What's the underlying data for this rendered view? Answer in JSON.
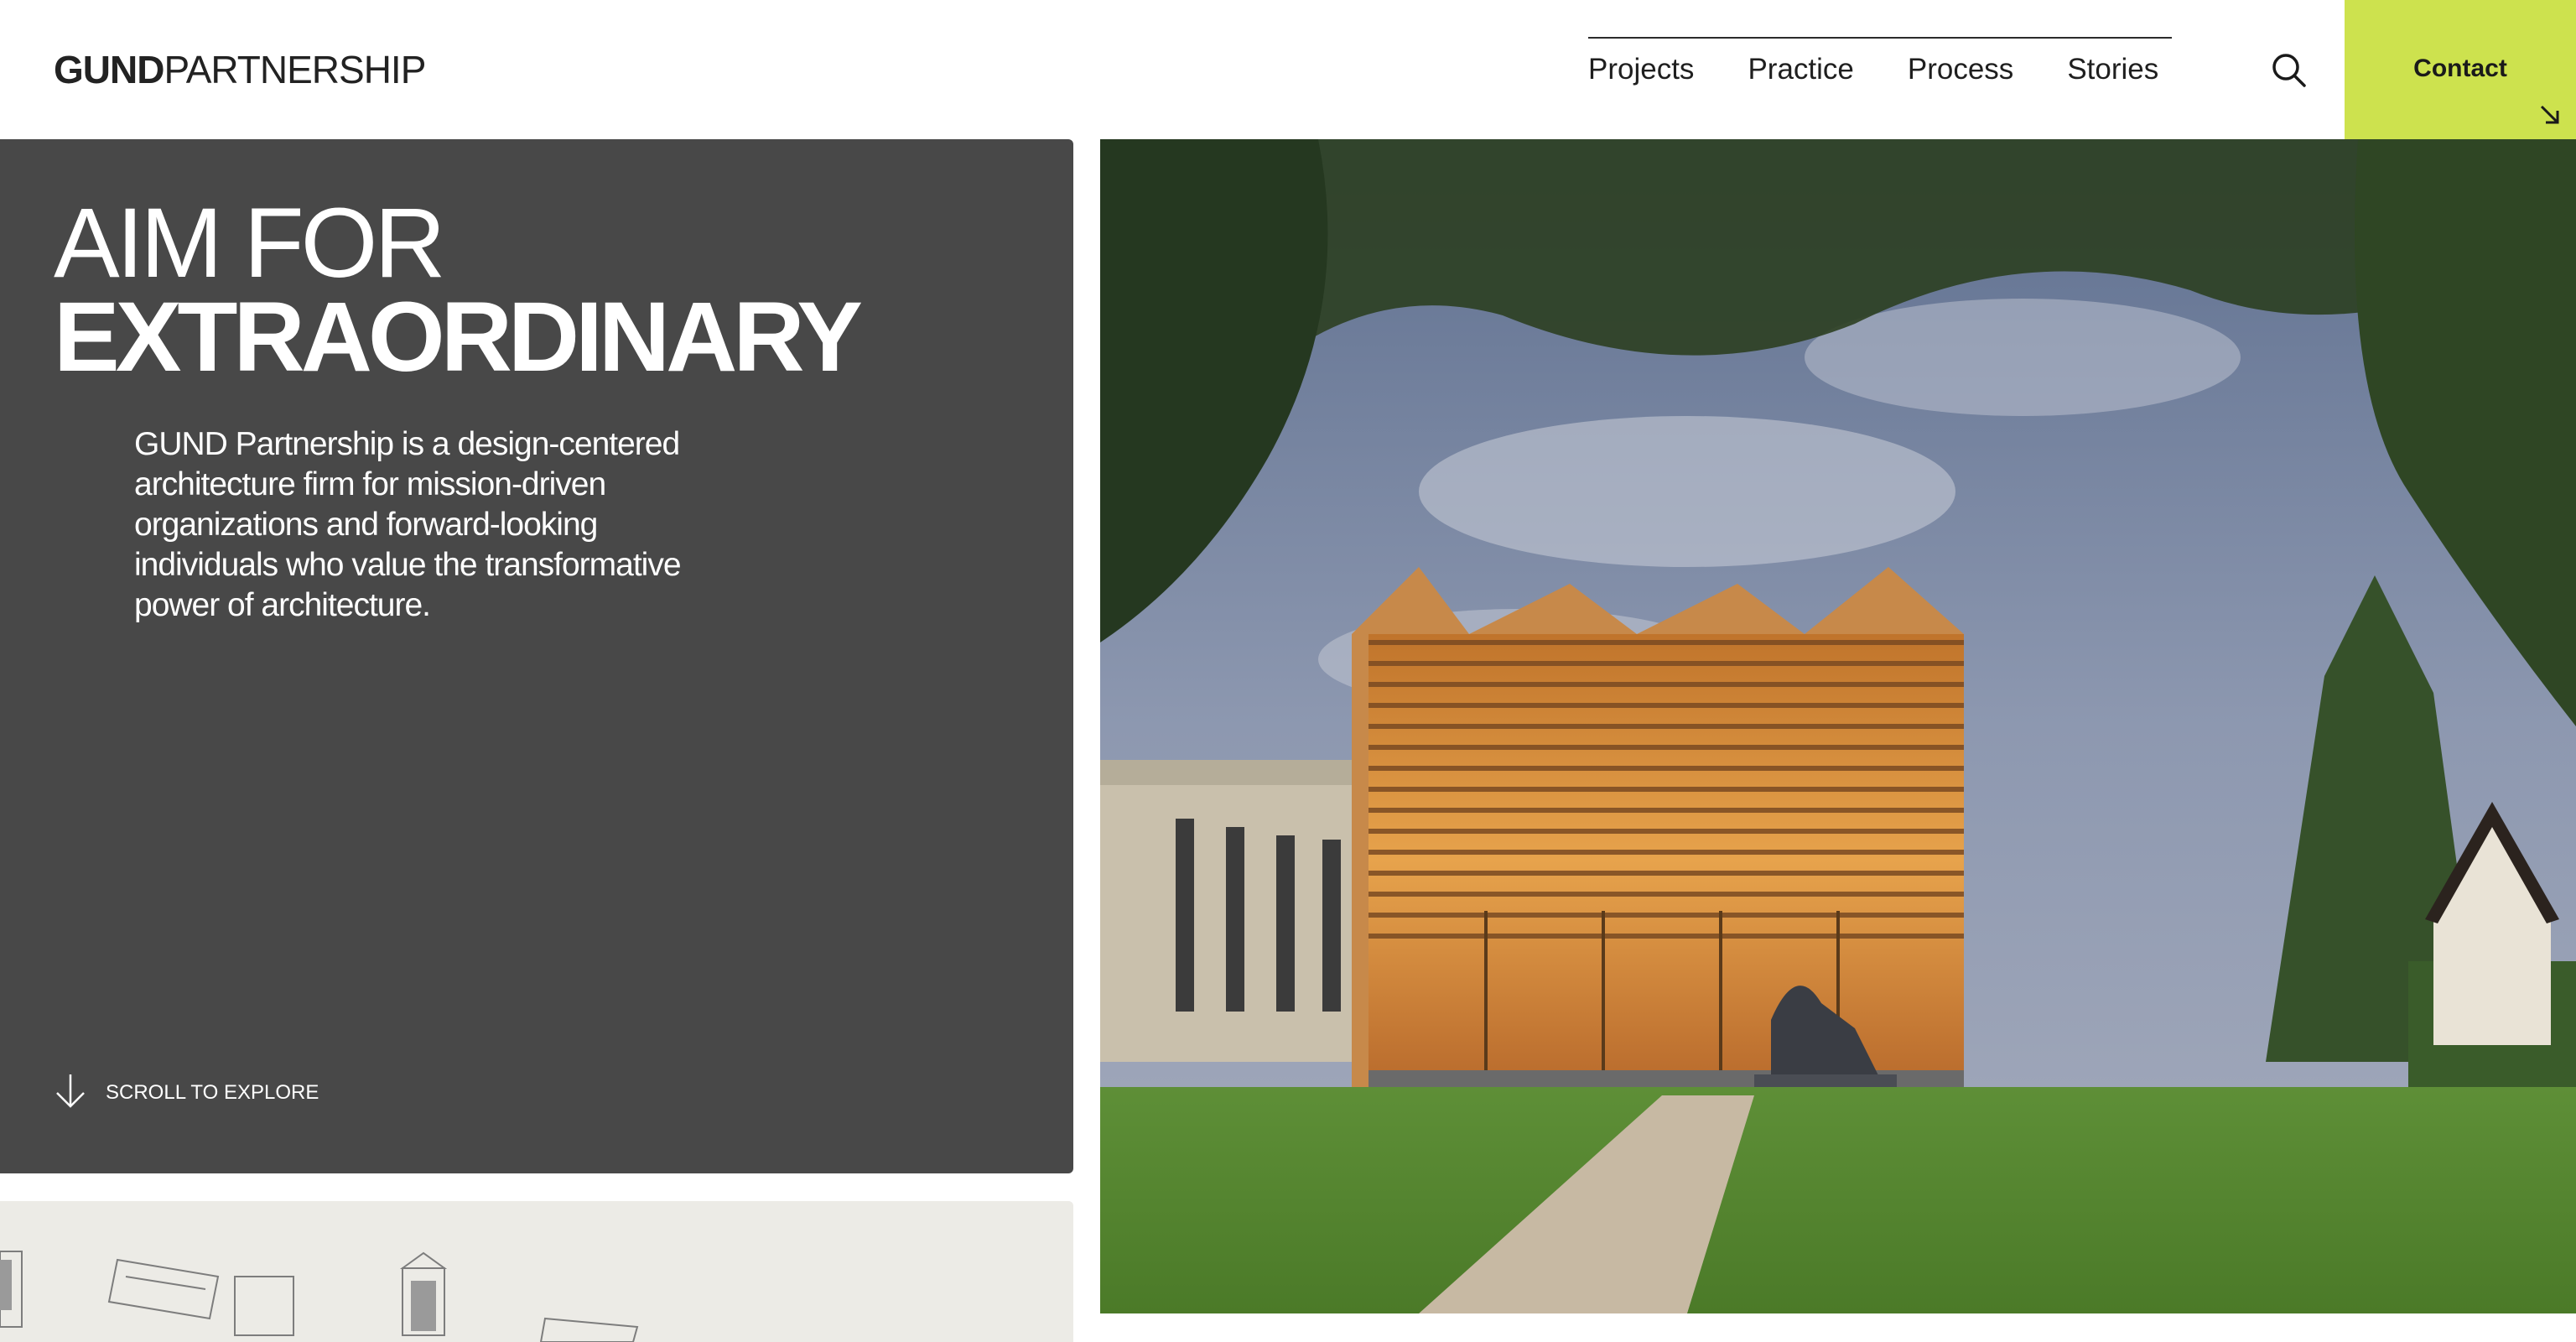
{
  "header": {
    "logo_bold": "GUND",
    "logo_light": "PARTNERSHIP",
    "nav": [
      {
        "label": "Projects"
      },
      {
        "label": "Practice"
      },
      {
        "label": "Process"
      },
      {
        "label": "Stories"
      }
    ],
    "search_icon": "search-icon",
    "contact_label": "Contact",
    "contact_icon": "arrow-down-right-icon",
    "accent_color": "#cde24e"
  },
  "hero": {
    "headline_line1": "AIM FOR",
    "headline_line2": "EXTRAORDINARY",
    "intro": "GUND Partnership is a design-centered architecture firm for mission-driven organizations and forward-looking individuals who value the transformative power of architecture.",
    "scroll_label": "SCROLL TO EXPLORE",
    "scroll_icon": "arrow-down-icon",
    "panel_color": "#484848"
  }
}
